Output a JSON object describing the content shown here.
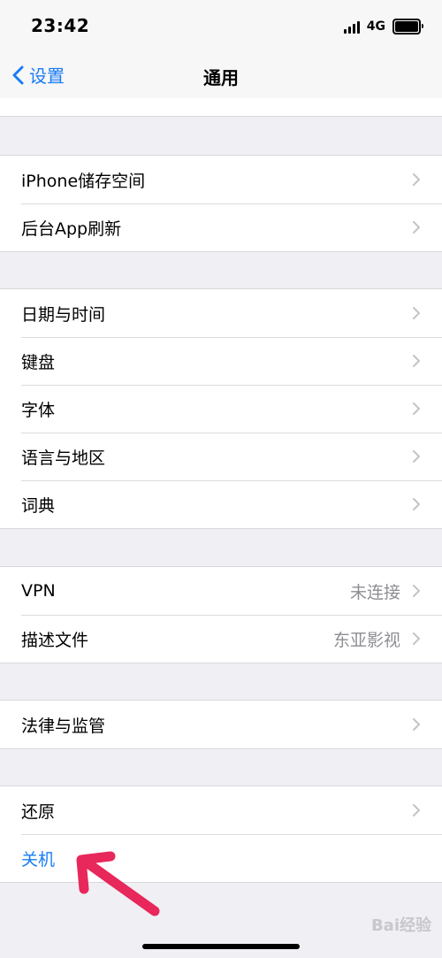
{
  "status": {
    "time": "23:42",
    "network": "4G"
  },
  "nav": {
    "back_label": "设置",
    "title": "通用"
  },
  "groups": [
    {
      "items": [
        {
          "label": "iPhone储存空间"
        },
        {
          "label": "后台App刷新"
        }
      ]
    },
    {
      "items": [
        {
          "label": "日期与时间"
        },
        {
          "label": "键盘"
        },
        {
          "label": "字体"
        },
        {
          "label": "语言与地区"
        },
        {
          "label": "词典"
        }
      ]
    },
    {
      "items": [
        {
          "label": "VPN",
          "value": "未连接"
        },
        {
          "label": "描述文件",
          "value": "东亚影视"
        }
      ]
    },
    {
      "items": [
        {
          "label": "法律与监管"
        }
      ]
    },
    {
      "items": [
        {
          "label": "还原"
        },
        {
          "label": "关机",
          "color": "#1a7cf5"
        }
      ]
    }
  ],
  "watermark": "Bai经验",
  "colors": {
    "accent": "#1a7cf5",
    "annotation_arrow": "#e8275a",
    "background": "#efeff4"
  }
}
